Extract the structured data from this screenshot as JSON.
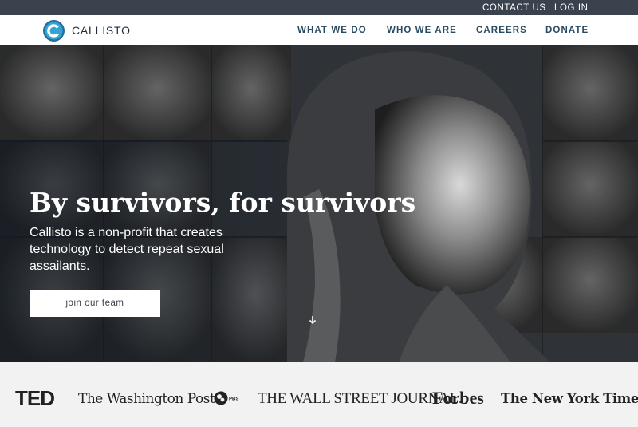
{
  "utility_nav": {
    "contact_label": "CONTACT US",
    "login_label": "LOG IN"
  },
  "brand": {
    "name": "CALLISTO",
    "logo_icon": "callisto-c-logo-icon",
    "logo_color": "#1f9bd0"
  },
  "main_nav": {
    "items": [
      {
        "label": "WHAT WE DO"
      },
      {
        "label": "WHO WE ARE"
      },
      {
        "label": "CAREERS"
      },
      {
        "label": "DONATE"
      }
    ]
  },
  "hero": {
    "title": "By survivors, for survivors",
    "description": "Callisto is a non-profit that creates technology to detect repeat sexual assailants.",
    "cta_label": "join our team",
    "scroll_icon": "arrow-down-icon"
  },
  "press": {
    "logos": [
      {
        "name": "TED"
      },
      {
        "name": "The Washington Post"
      },
      {
        "name": "PBS"
      },
      {
        "name": "THE WALL STREET JOURNAL."
      },
      {
        "name": "Forbes"
      },
      {
        "name": "The New York Times"
      }
    ]
  },
  "colors": {
    "utility_bar": "#3a424d",
    "nav_text": "#294a61",
    "press_bg": "#f2f2f2",
    "cta_bg": "#ffffff"
  }
}
